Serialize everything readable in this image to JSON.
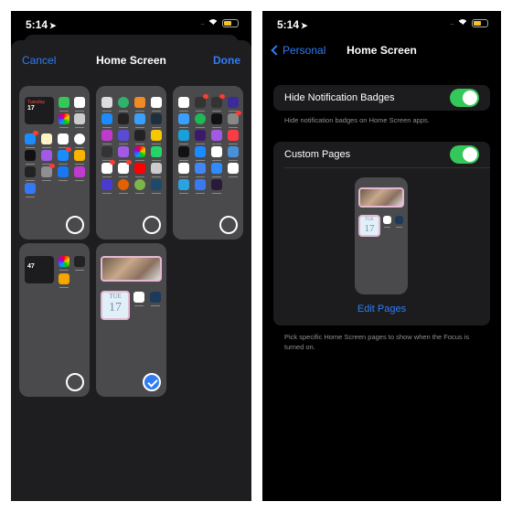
{
  "status_bar": {
    "time": "5:14",
    "location_icon": "location-arrow-icon",
    "wifi_icon": "wifi-icon",
    "battery_icon": "battery-charging-icon"
  },
  "left": {
    "cancel_label": "Cancel",
    "title": "Home Screen",
    "done_label": "Done",
    "pages": [
      {
        "selected": false
      },
      {
        "selected": false
      },
      {
        "selected": false
      },
      {
        "selected": false
      },
      {
        "selected": true
      }
    ],
    "page1_widget": {
      "month": "Tuesday",
      "day": "17"
    },
    "page4_widget": {
      "temp": "47"
    },
    "page5_calendar": {
      "weekday": "TUE",
      "day": "17"
    }
  },
  "right": {
    "back_label": "Personal",
    "title": "Home Screen",
    "hide_badges": {
      "label": "Hide Notification Badges",
      "enabled": true,
      "footer": "Hide notification badges on Home Screen apps."
    },
    "custom_pages": {
      "label": "Custom Pages",
      "enabled": true,
      "edit_label": "Edit Pages",
      "footer": "Pick specific Home Screen pages to show when the Focus is turned on."
    },
    "preview_calendar": {
      "weekday": "TUE",
      "day": "17"
    }
  },
  "colors": {
    "accent": "#2e7cf6",
    "toggle_on": "#34c759"
  }
}
